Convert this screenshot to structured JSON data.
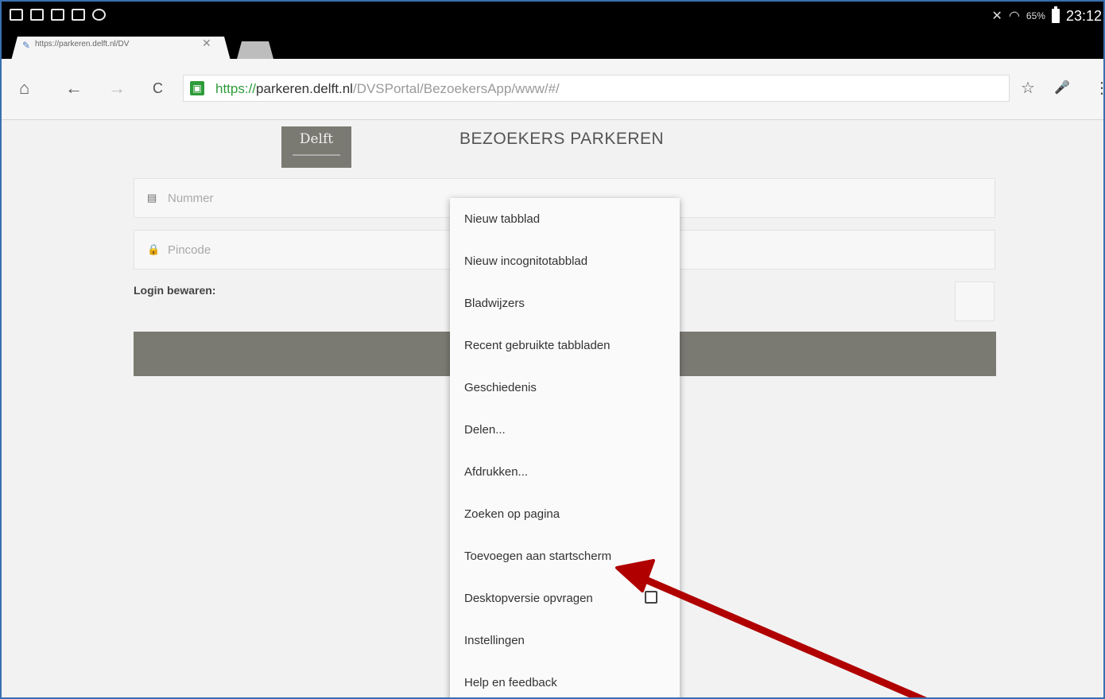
{
  "status_bar": {
    "battery_percent": "65%",
    "time": "23:12"
  },
  "tab": {
    "title": "https://parkeren.delft.nl/DV",
    "close": "✕"
  },
  "toolbar": {
    "home": "⌂",
    "back": "←",
    "forward": "→",
    "reload": "C",
    "bookmark": "☆",
    "mic": "🎤",
    "overflow": "⋮"
  },
  "url": {
    "scheme": "https://",
    "host": "parkeren.delft.nl",
    "path": "/DVSPortal/BezoekersApp/www/#/"
  },
  "page": {
    "logo_text": "Delft",
    "title": "BEZOEKERS PARKEREN",
    "nummer_placeholder": "Nummer",
    "pincode_placeholder": "Pincode",
    "login_label": "Login bewaren:"
  },
  "menu": {
    "items": [
      "Nieuw tabblad",
      "Nieuw incognitotabblad",
      "Bladwijzers",
      "Recent gebruikte tabbladen",
      "Geschiedenis",
      "Delen...",
      "Afdrukken...",
      "Zoeken op pagina",
      "Toevoegen aan startscherm",
      "Desktopversie opvragen",
      "Instellingen",
      "Help en feedback"
    ]
  },
  "colors": {
    "accent_olive": "#7b7a72",
    "secure_green": "#2e9c3a",
    "annotation_arrow": "#b00000"
  }
}
